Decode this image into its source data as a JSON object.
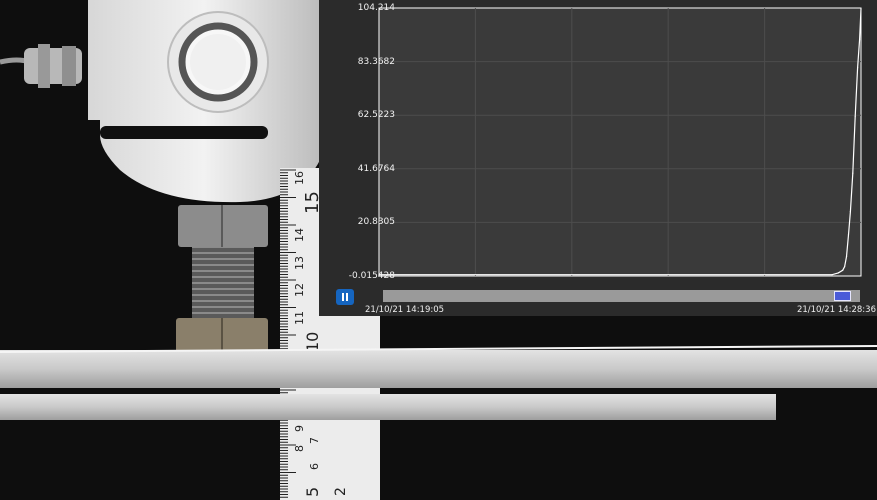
{
  "scene": {
    "description_icon": "load-cell-bending-test-photo",
    "ruler_numbers": [
      "16",
      "15",
      "14",
      "13",
      "12",
      "11",
      "10",
      "9",
      "8",
      "7",
      "6",
      "5",
      "2"
    ]
  },
  "graph": {
    "y_ticks": [
      "104.214",
      "83.3682",
      "62.5223",
      "41.6764",
      "20.8305",
      "-0.015428"
    ],
    "start_time": "21/10/21 14:19:05",
    "end_time": "21/10/21 14:28:36",
    "scrollbar_position": 0.98,
    "pause_icon": "pause-icon",
    "colors": {
      "panel_bg": "#2b2b2b",
      "plot_bg": "#3a3a3a",
      "grid": "#4d4d4d",
      "line": "#ffffff",
      "accent": "#1565c0"
    }
  },
  "chart_data": {
    "type": "line",
    "title": "",
    "xlabel": "",
    "ylabel": "",
    "xlim": [
      0,
      1
    ],
    "ylim": [
      -0.015428,
      104.214
    ],
    "grid": true,
    "legend": "none",
    "x_note": "normalized fraction of time window 14:19:05 to 14:28:36",
    "series": [
      {
        "x": [
          0,
          0.94,
          0.953,
          0.962,
          0.966,
          0.97,
          0.974,
          0.978,
          0.983,
          0.988,
          0.993,
          0.997,
          1.0
        ],
        "y": [
          0.5,
          0.5,
          1.2,
          2.2,
          3.6,
          7.5,
          16,
          25,
          40,
          62,
          81,
          92,
          104
        ]
      }
    ]
  }
}
